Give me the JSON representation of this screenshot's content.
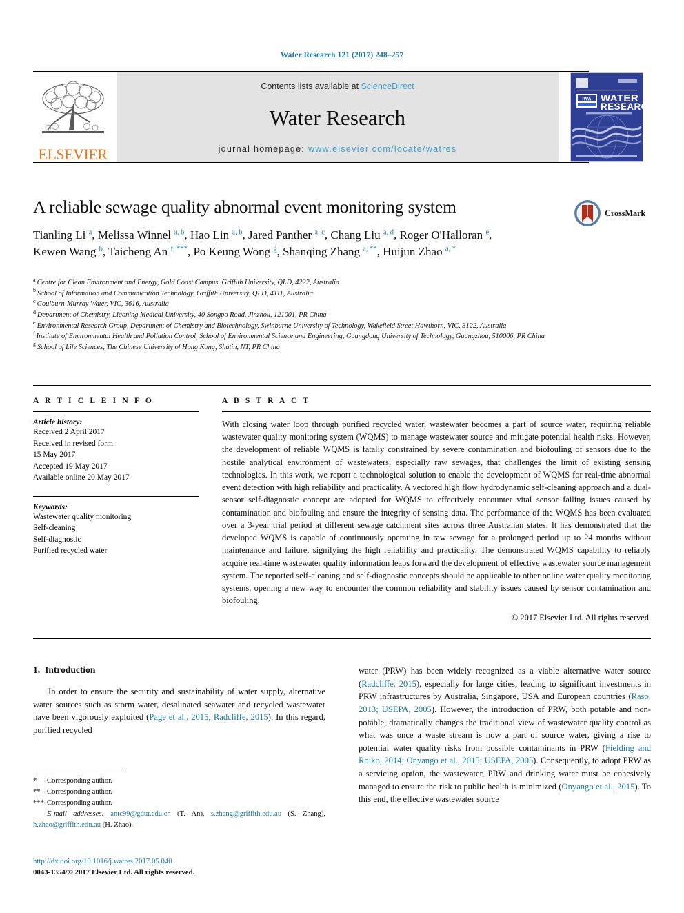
{
  "running_head": "Water Research 121 (2017) 248–257",
  "masthead": {
    "contents_prefix": "Contents lists available at ",
    "contents_link": "ScienceDirect",
    "journal_title": "Water Research",
    "homepage_prefix": "journal homepage: ",
    "homepage_link": "www.elsevier.com/locate/watres",
    "publisher_name": "ELSEVIER",
    "cover_title_line1": "WATER",
    "cover_title_line2": "RESEARCH",
    "cover_badge": "IWA"
  },
  "article": {
    "title": "A reliable sewage quality abnormal event monitoring system",
    "crossmark_label": "CrossMark",
    "authors": [
      {
        "name": "Tianling Li",
        "sup": "a",
        "sep": ", "
      },
      {
        "name": "Melissa Winnel",
        "sup": "a, b",
        "sep": ", "
      },
      {
        "name": "Hao Lin",
        "sup": "a, b",
        "sep": ", "
      },
      {
        "name": "Jared Panther",
        "sup": "a, c",
        "sep": ", "
      },
      {
        "name": "Chang Liu",
        "sup": "a, d",
        "sep": ", "
      },
      {
        "name": "Roger O'Halloran",
        "sup": "e",
        "sep": ", "
      },
      {
        "name": "Kewen Wang",
        "sup": "b",
        "sep": ", "
      },
      {
        "name": "Taicheng An",
        "sup": "f, ***",
        "sep": ", "
      },
      {
        "name": "Po Keung Wong",
        "sup": "g",
        "sep": ", "
      },
      {
        "name": "Shanqing Zhang",
        "sup": "a, **",
        "sep": ", "
      },
      {
        "name": "Huijun Zhao",
        "sup": "a, *",
        "sep": ""
      }
    ],
    "affiliations": [
      {
        "mark": "a",
        "text": "Centre for Clean Environment and Energy, Gold Coast Campus, Griffith University, QLD, 4222, Australia"
      },
      {
        "mark": "b",
        "text": "School of Information and Communication Technology, Griffith University, QLD, 4111, Australia"
      },
      {
        "mark": "c",
        "text": "Goulburn-Murray Water, VIC, 3616, Australia"
      },
      {
        "mark": "d",
        "text": "Department of Chemistry, Liaoning Medical University, 40 Songpo Road, Jinzhou, 121001, PR China"
      },
      {
        "mark": "e",
        "text": "Environmental Research Group, Department of Chemistry and Biotechnology, Swinburne University of Technology, Wakefield Street Hawthorn, VIC, 3122, Australia"
      },
      {
        "mark": "f",
        "text": "Institute of Environmental Health and Pollution Control, School of Environmental Science and Engineering, Guangdong University of Technology, Guangzhou, 510006, PR China"
      },
      {
        "mark": "g",
        "text": "School of Life Sciences, The Chinese University of Hong Kong, Shatin, NT, PR China"
      }
    ]
  },
  "article_info": {
    "heading": "A R T I C L E  I N F O",
    "history_label": "Article history:",
    "history": [
      "Received 2 April 2017",
      "Received in revised form",
      "15 May 2017",
      "Accepted 19 May 2017",
      "Available online 20 May 2017"
    ],
    "keywords_label": "Keywords:",
    "keywords": [
      "Wastewater quality monitoring",
      "Self-cleaning",
      "Self-diagnostic",
      "Purified recycled water"
    ]
  },
  "abstract": {
    "heading": "A B S T R A C T",
    "text": "With closing water loop through purified recycled water, wastewater becomes a part of source water, requiring reliable wastewater quality monitoring system (WQMS) to manage wastewater source and mitigate potential health risks. However, the development of reliable WQMS is fatally constrained by severe contamination and biofouling of sensors due to the hostile analytical environment of wastewaters, especially raw sewages, that challenges the limit of existing sensing technologies. In this work, we report a technological solution to enable the development of WQMS for real-time abnormal event detection with high reliability and practicality. A vectored high flow hydrodynamic self-cleaning approach and a dual-sensor self-diagnostic concept are adopted for WQMS to effectively encounter vital sensor failing issues caused by contamination and biofouling and ensure the integrity of sensing data. The performance of the WQMS has been evaluated over a 3-year trial period at different sewage catchment sites across three Australian states. It has demonstrated that the developed WQMS is capable of continuously operating in raw sewage for a prolonged period up to 24 months without maintenance and failure, signifying the high reliability and practicality. The demonstrated WQMS capability to reliably acquire real-time wastewater quality information leaps forward the development of effective wastewater source management system. The reported self-cleaning and self-diagnostic concepts should be applicable to other online water quality monitoring systems, opening a new way to encounter the common reliability and stability issues caused by sensor contamination and biofouling.",
    "copyright": "© 2017 Elsevier Ltd. All rights reserved."
  },
  "introduction": {
    "number": "1.",
    "title": "Introduction",
    "left_paragraph": {
      "part1": "In order to ensure the security and sustainability of water supply, alternative water sources such as storm water, desalinated seawater and recycled wastewater have been vigorously exploited (",
      "cite1": "Page et al., 2015; Radcliffe, 2015",
      "part2": "). In this regard, purified recycled"
    },
    "right_paragraph": {
      "part1": "water (PRW) has been widely recognized as a viable alternative water source (",
      "cite1": "Radcliffe, 2015",
      "part2": "), especially for large cities, leading to significant investments in PRW infrastructures by Australia, Singapore, USA and European countries (",
      "cite2": "Raso, 2013; USEPA, 2005",
      "part3": "). However, the introduction of PRW, both potable and non-potable, dramatically changes the traditional view of wastewater quality control as what was once a waste stream is now a part of source water, giving a rise to potential water quality risks from possible contaminants in PRW (",
      "cite3": "Fielding and Roiko, 2014; Onyango et al., 2015; USEPA, 2005",
      "part4": "). Consequently, to adopt PRW as a servicing option, the wastewater, PRW and drinking water must be cohesively managed to ensure the risk to public health is minimized (",
      "cite4": "Onyango et al., 2015",
      "part5": "). To this end, the effective wastewater source"
    }
  },
  "footnotes": {
    "corresponding": [
      {
        "mark": "*",
        "text": "Corresponding author."
      },
      {
        "mark": "**",
        "text": "Corresponding author."
      },
      {
        "mark": "***",
        "text": "Corresponding author."
      }
    ],
    "email_label": "E-mail addresses:",
    "emails": [
      {
        "address": "antc99@gdut.edu.cn",
        "owner": "(T. An)",
        "sep": ", "
      },
      {
        "address": "s.zhang@griffith.edu.au",
        "owner": "(S. Zhang)",
        "sep": ", "
      },
      {
        "address": "h.zhao@griffith.edu.au",
        "owner": "(H. Zhao)",
        "sep": "."
      }
    ]
  },
  "imprint": {
    "doi": "http://dx.doi.org/10.1016/j.watres.2017.05.040",
    "issn_line": "0043-1354/© 2017 Elsevier Ltd. All rights reserved."
  },
  "colors": {
    "link_blue": "#1a7aad",
    "sd_blue": "#3f9ec9",
    "elsevier_orange": "#E87722",
    "cover_blue": "#2a3b8f",
    "masthead_grey": "#e3e3e3"
  }
}
